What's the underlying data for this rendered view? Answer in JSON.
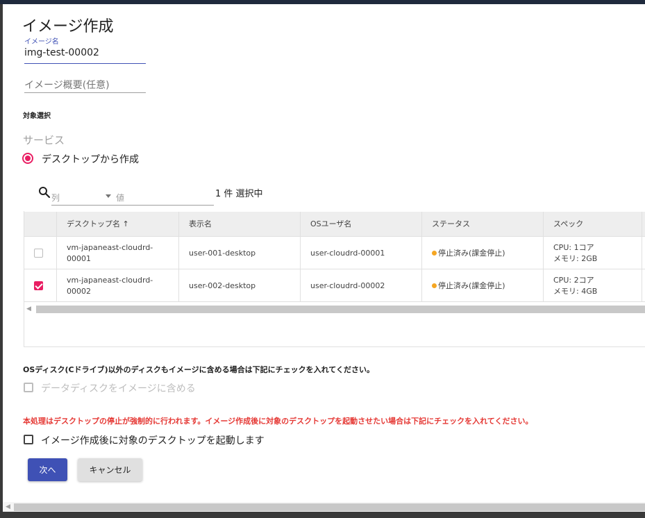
{
  "dialog": {
    "title": "イメージ作成"
  },
  "image_name": {
    "label": "イメージ名",
    "value": "img-test-00002"
  },
  "image_description": {
    "placeholder": "イメージ概要(任意)"
  },
  "target": {
    "section_label": "対象選択",
    "service_label": "サービス",
    "radio_option": "デスクトップから作成",
    "radio_selected": true
  },
  "filter": {
    "column_placeholder": "列",
    "value_placeholder": "値",
    "selected_count": "1 件 選択中"
  },
  "table": {
    "headers": [
      "デスクトップ名 ↑",
      "表示名",
      "OSユーザ名",
      "ステータス",
      "スペック"
    ],
    "rows": [
      {
        "checked": false,
        "desktop_name_1": "vm-japaneast-cloudrd-",
        "desktop_name_2": "00001",
        "display_name": "user-001-desktop",
        "os_user": "user-cloudrd-00001",
        "status": "停止済み(課金停止)",
        "spec_cpu": "CPU: 1コア",
        "spec_mem": "メモリ: 2GB"
      },
      {
        "checked": true,
        "desktop_name_1": "vm-japaneast-cloudrd-",
        "desktop_name_2": "00002",
        "display_name": "user-002-desktop",
        "os_user": "user-cloudrd-00002",
        "status": "停止済み(課金停止)",
        "spec_cpu": "CPU: 2コア",
        "spec_mem": "メモリ: 4GB"
      }
    ]
  },
  "options": {
    "disk_note": "OSディスク(Cドライブ)以外のディスクもイメージに含める場合は下記にチェックを入れてください。",
    "include_data_disk_label": "データディスクをイメージに含める",
    "include_data_disk_checked": false,
    "warning": "本処理はデスクトップの停止が強制的に行われます。イメージ作成後に対象のデスクトップを起動させたい場合は下記にチェックを入れてください。",
    "start_after_label": "イメージ作成後に対象のデスクトップを起動します",
    "start_after_checked": false
  },
  "buttons": {
    "next": "次へ",
    "cancel": "キャンセル"
  },
  "colors": {
    "primary": "#3f51b5",
    "accent": "#e91e63",
    "warning_text": "#e53935",
    "status_stopped": "#f5a623"
  }
}
